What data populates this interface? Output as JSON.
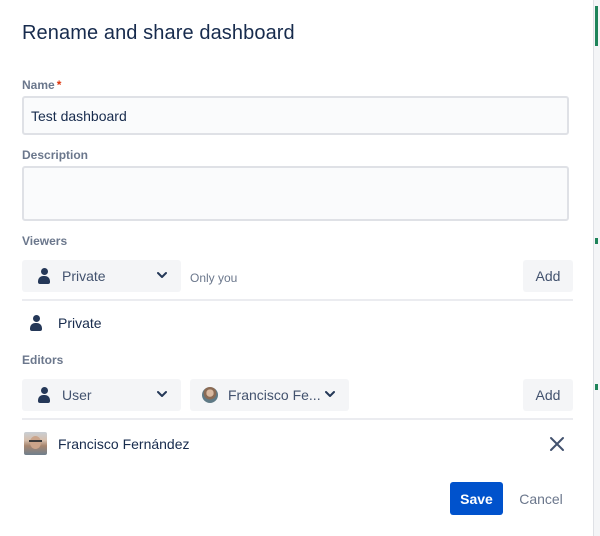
{
  "dialog": {
    "title": "Rename and share dashboard"
  },
  "name_field": {
    "label": "Name",
    "required_mark": "*",
    "value": "Test dashboard"
  },
  "description_field": {
    "label": "Description",
    "value": ""
  },
  "viewers": {
    "label": "Viewers",
    "select_value": "Private",
    "helper_text": "Only you",
    "add_label": "Add",
    "list": [
      {
        "label": "Private",
        "icon": "person-icon"
      }
    ]
  },
  "editors": {
    "label": "Editors",
    "type_select_value": "User",
    "user_select_value": "Francisco Fe...",
    "add_label": "Add",
    "list": [
      {
        "name": "Francisco Fernández",
        "icon": "user-avatar"
      }
    ]
  },
  "footer": {
    "save_label": "Save",
    "cancel_label": "Cancel"
  },
  "colors": {
    "primary": "#0052cc",
    "text": "#172b4d",
    "subtle": "#6b778c",
    "field_bg": "#fafbfc",
    "button_bg": "#f4f5f7",
    "required": "#de350b"
  }
}
